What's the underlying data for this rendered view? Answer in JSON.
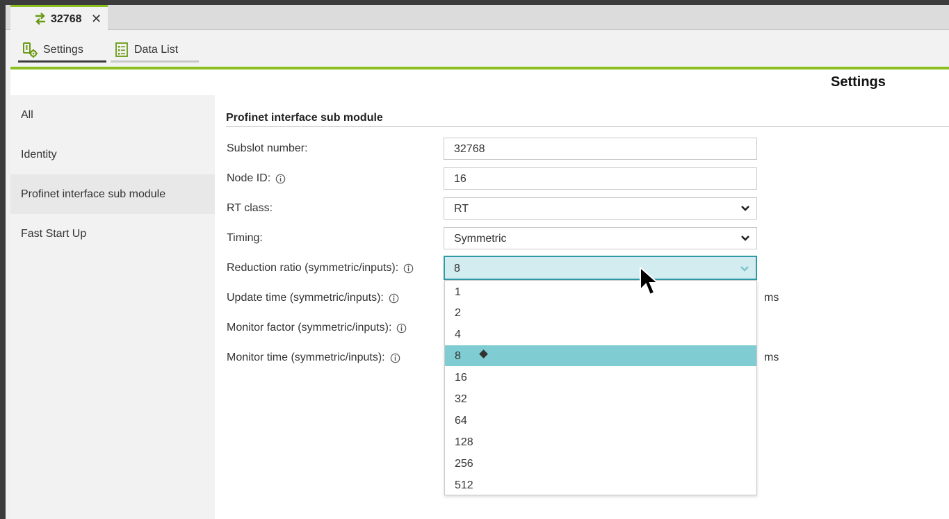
{
  "document_tab": {
    "title": "32768",
    "close_glyph": "✕",
    "icon": "swap-arrows-icon"
  },
  "subtabs": [
    {
      "label": "Settings",
      "icon": "settings-gear-icon",
      "active": true
    },
    {
      "label": "Data List",
      "icon": "list-icon",
      "active": false
    }
  ],
  "page_title": "Settings",
  "nav": {
    "items": [
      {
        "label": "All"
      },
      {
        "label": "Identity"
      },
      {
        "label": "Profinet interface sub module",
        "active": true
      },
      {
        "label": "Fast Start Up"
      }
    ]
  },
  "section": {
    "title": "Profinet interface sub module",
    "fields": {
      "subslot": {
        "label": "Subslot number:",
        "value": "32768"
      },
      "node_id": {
        "label": "Node ID:",
        "value": "16",
        "info": true
      },
      "rt_class": {
        "label": "RT class:",
        "value": "RT"
      },
      "timing": {
        "label": "Timing:",
        "value": "Symmetric"
      },
      "reduction_ratio": {
        "label": "Reduction ratio (symmetric/inputs):",
        "value": "8",
        "info": true
      },
      "update_time": {
        "label": "Update time (symmetric/inputs):",
        "unit": "ms",
        "info": true
      },
      "monitor_factor": {
        "label": "Monitor factor (symmetric/inputs):",
        "info": true
      },
      "monitor_time": {
        "label": "Monitor time (symmetric/inputs):",
        "unit": "ms",
        "info": true
      }
    }
  },
  "dropdown": {
    "options": [
      "1",
      "2",
      "4",
      "8",
      "16",
      "32",
      "64",
      "128",
      "256",
      "512"
    ],
    "selected": "8"
  },
  "colors": {
    "accent_green": "#8bbf1f",
    "focus_teal": "#2e9aa6",
    "selected_option": "#7fcdd2",
    "focused_field_bg": "#d3ecef"
  }
}
